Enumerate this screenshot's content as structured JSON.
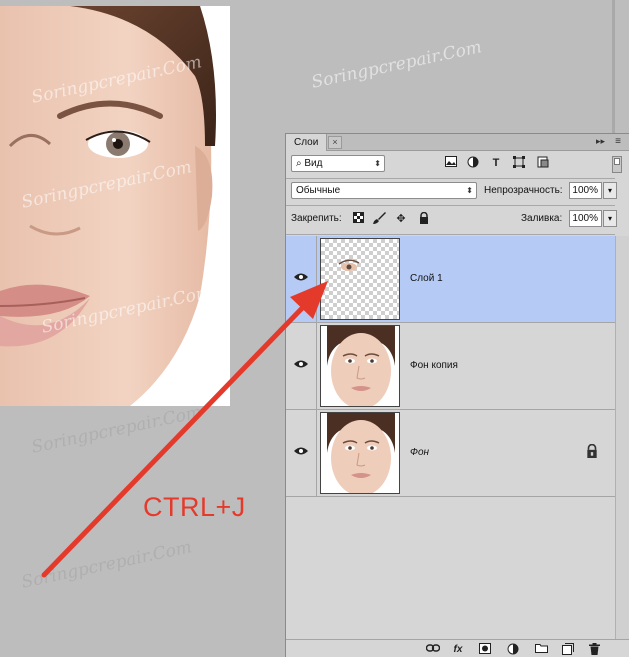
{
  "watermark": "Soringpcrepair.Com",
  "annotation": "CTRL+J",
  "panel": {
    "tab_label": "Слои",
    "tab_close": "×",
    "expand_label": "▸▸",
    "menu_label": "≡",
    "filter": {
      "label": "Вид",
      "search_glyph": "⌕"
    },
    "blend_mode": "Обычные",
    "opacity_label": "Непрозрачность:",
    "opacity_value": "100%",
    "lock_label": "Закрепить:",
    "fill_label": "Заливка:",
    "fill_value": "100%",
    "layers": [
      {
        "name": "Слой 1",
        "selected": true
      },
      {
        "name": "Фон копия",
        "selected": false
      },
      {
        "name": "Фон",
        "selected": false,
        "locked": true
      }
    ],
    "bottom_icons": [
      "link-icon",
      "fx-icon",
      "mask-icon",
      "adjustment-icon",
      "folder-icon",
      "new-layer-icon",
      "trash-icon"
    ],
    "fx_label": "fx"
  },
  "colors": {
    "selection": "#b5cbf5",
    "arrow": "#e43a2c"
  }
}
